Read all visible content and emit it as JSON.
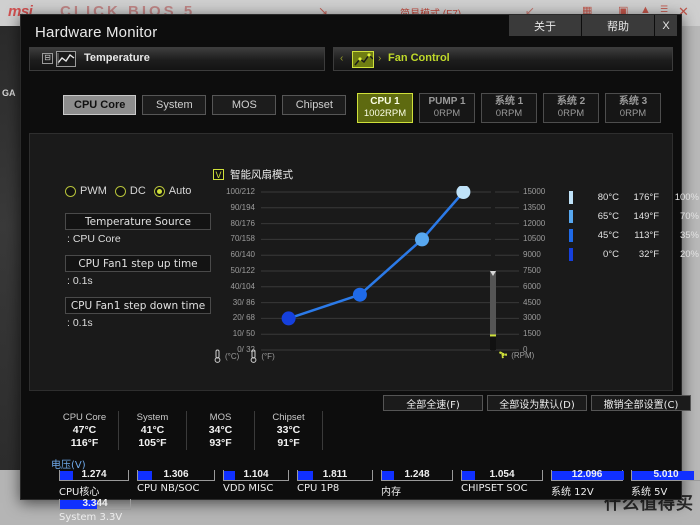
{
  "bios": {
    "logo": "msi",
    "brand": "CLICK BIOS 5",
    "easy_mode": "简易模式 (F7)",
    "left_strip": "GA",
    "watermark": "什么值得买"
  },
  "window": {
    "title": "Hardware Monitor",
    "top_buttons": [
      {
        "label": "关于",
        "name": "about-button"
      },
      {
        "label": "帮助",
        "name": "help-button"
      },
      {
        "label": "X",
        "name": "close-button"
      }
    ]
  },
  "panels": {
    "left_header": "Temperature",
    "right_header": "Fan Control",
    "chevron_left": "‹",
    "chevron_right": "›"
  },
  "sensor_tabs": [
    {
      "label": "CPU Core",
      "active": true
    },
    {
      "label": "System",
      "active": false
    },
    {
      "label": "MOS",
      "active": false
    },
    {
      "label": "Chipset",
      "active": false
    }
  ],
  "fan_tabs": [
    {
      "name": "CPU 1",
      "rpm": "1002RPM",
      "active": true
    },
    {
      "name": "PUMP 1",
      "rpm": "0RPM",
      "active": false
    },
    {
      "name": "系统 1",
      "rpm": "0RPM",
      "active": false
    },
    {
      "name": "系统 2",
      "rpm": "0RPM",
      "active": false
    },
    {
      "name": "系统 3",
      "rpm": "0RPM",
      "active": false
    }
  ],
  "controls": {
    "modes": [
      {
        "label": "PWM",
        "selected": false
      },
      {
        "label": "DC",
        "selected": false
      },
      {
        "label": "Auto",
        "selected": true
      }
    ],
    "fields": [
      {
        "button": "Temperature Source",
        "value": ": CPU Core"
      },
      {
        "button": "CPU Fan1 step up time",
        "value": ": 0.1s"
      },
      {
        "button": "CPU Fan1 step down time",
        "value": ": 0.1s"
      }
    ]
  },
  "smart_mode": {
    "label": "智能风扇模式",
    "checked": true,
    "check_glyph": "V"
  },
  "chart_data": {
    "type": "line",
    "title": "智能风扇模式",
    "xlabel": "(RPM)",
    "ylabel": "(°C) / (°F)",
    "y_ticks_c": [
      100,
      90,
      80,
      70,
      60,
      50,
      40,
      30,
      20,
      10,
      0
    ],
    "y_ticks_f": [
      212,
      194,
      176,
      158,
      140,
      122,
      104,
      86,
      68,
      50,
      32
    ],
    "y_tick_labels": [
      "100/212",
      "90/194",
      "80/176",
      "70/158",
      "60/140",
      "50/122",
      "40/104",
      "30/ 86",
      "20/ 68",
      "10/ 50",
      "0/ 32"
    ],
    "right_ticks": [
      15000,
      13500,
      12000,
      10500,
      9000,
      7500,
      6000,
      4500,
      3000,
      1500,
      0
    ],
    "ylim": [
      0,
      100
    ],
    "right_ylim": [
      0,
      15000
    ],
    "grid": true,
    "legend_position": "right",
    "series": [
      {
        "name": "fan-curve",
        "points": [
          {
            "x": 12,
            "temp_c": 0,
            "percent": 20,
            "color": "#1540dd"
          },
          {
            "x": 43,
            "temp_c": 45,
            "percent": 35,
            "color": "#1f6ae8"
          },
          {
            "x": 70,
            "temp_c": 65,
            "percent": 70,
            "color": "#58a8f0"
          },
          {
            "x": 88,
            "temp_c": 80,
            "percent": 100,
            "color": "#bfe2f8"
          }
        ]
      }
    ],
    "legend": [
      {
        "temp_c": "80°C",
        "temp_f": "176°F",
        "percent": "100%",
        "color": "#bfe2f8"
      },
      {
        "temp_c": "65°C",
        "temp_f": "149°F",
        "percent": "70%",
        "color": "#58a8f0"
      },
      {
        "temp_c": "45°C",
        "temp_f": "113°F",
        "percent": "35%",
        "color": "#1f6ae8"
      },
      {
        "temp_c": "0°C",
        "temp_f": "32°F",
        "percent": "20%",
        "color": "#1540dd"
      }
    ],
    "rpm_slider": {
      "value": 1002,
      "max": 15000,
      "handle_position": 7500
    }
  },
  "footer_icons": {
    "celsius": "(°C)",
    "fahrenheit": "(°F)",
    "rpm": "(RPM)"
  },
  "actions": [
    {
      "label": "全部全速(F)"
    },
    {
      "label": "全部设为默认(D)"
    },
    {
      "label": "撤销全部设置(C)"
    }
  ],
  "temperature_summary": [
    {
      "name": "CPU Core",
      "c": "47°C",
      "f": "116°F"
    },
    {
      "name": "System",
      "c": "41°C",
      "f": "105°F"
    },
    {
      "name": "MOS",
      "c": "34°C",
      "f": "93°F"
    },
    {
      "name": "Chipset",
      "c": "33°C",
      "f": "91°F"
    }
  ],
  "voltage": {
    "title": "电压(V)",
    "row1": [
      {
        "name": "CPU核心",
        "value": "1.274",
        "fill": 18
      },
      {
        "name": "CPU NB/SOC",
        "value": "1.306",
        "fill": 18
      },
      {
        "name": "VDD MISC",
        "value": "1.104",
        "fill": 16
      },
      {
        "name": "CPU 1P8",
        "value": "1.811",
        "fill": 20
      },
      {
        "name": "内存",
        "value": "1.248",
        "fill": 17
      },
      {
        "name": "CHIPSET SOC",
        "value": "1.054",
        "fill": 16
      },
      {
        "name": "系统 12V",
        "value": "12.096",
        "fill": 100
      },
      {
        "name": "系统 5V",
        "value": "5.010",
        "fill": 88
      }
    ],
    "row2": [
      {
        "name": "System 3.3V",
        "value": "3.344",
        "fill": 52
      }
    ]
  }
}
